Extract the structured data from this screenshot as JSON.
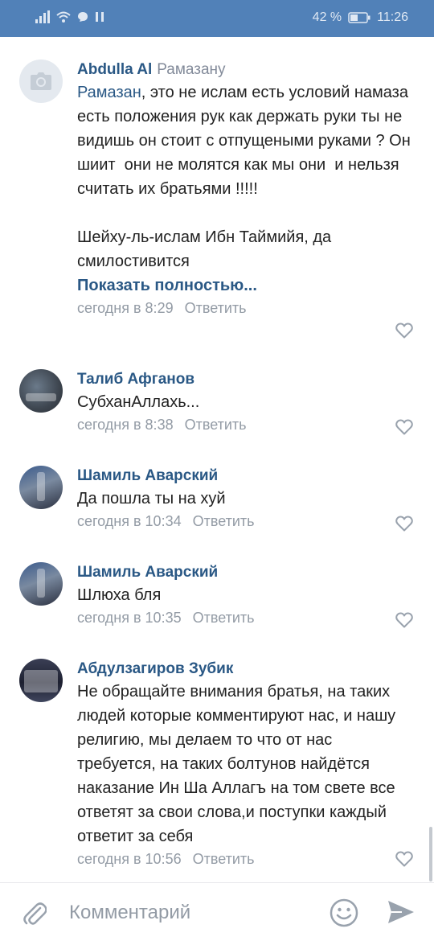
{
  "status_bar": {
    "battery_percent": "42 %",
    "time": "11:26"
  },
  "comments": [
    {
      "author": "Abdulla Al",
      "reply_to": "Рамазану",
      "mention": "Рамазан",
      "text": ", это не ислам есть условий намаза есть положения рук как держать руки ты не видишь он стоит с отпущеными руками ? Он шиит  они не молятся как мы они  и нельзя считать их братьями !!!!!\n\nШейху-ль-ислам Ибн Таймийя, да смилостивится",
      "show_more": "Показать полностью...",
      "time": "сегодня в 8:29",
      "reply_label": "Ответить"
    },
    {
      "author": "Талиб Афганов",
      "text": "СубханАллахь...",
      "time": "сегодня в 8:38",
      "reply_label": "Ответить"
    },
    {
      "author": "Шамиль Аварский",
      "text": "Да пошла ты на хуй",
      "time": "сегодня в 10:34",
      "reply_label": "Ответить"
    },
    {
      "author": "Шамиль Аварский",
      "text": "Шлюха бля",
      "time": "сегодня в 10:35",
      "reply_label": "Ответить"
    },
    {
      "author": "Абдулзагиров Зубик",
      "text": "Не обращайте внимания братья, на таких людей которые комментируют нас, и нашу религию, мы делаем то что от нас требуется, на таких болтунов найдётся наказание Ин Ша Аллагъ на том свете все ответят за свои слова,и поступки каждый ответит за себя",
      "time": "сегодня в 10:56",
      "reply_label": "Ответить"
    }
  ],
  "composer": {
    "placeholder": "Комментарий",
    "icons": [
      "paperclip-icon",
      "smile-icon",
      "send-icon"
    ]
  },
  "colors": {
    "status_bar": "#5181b8",
    "link": "#2a5885",
    "meta": "#939ba5",
    "text": "#222222"
  }
}
